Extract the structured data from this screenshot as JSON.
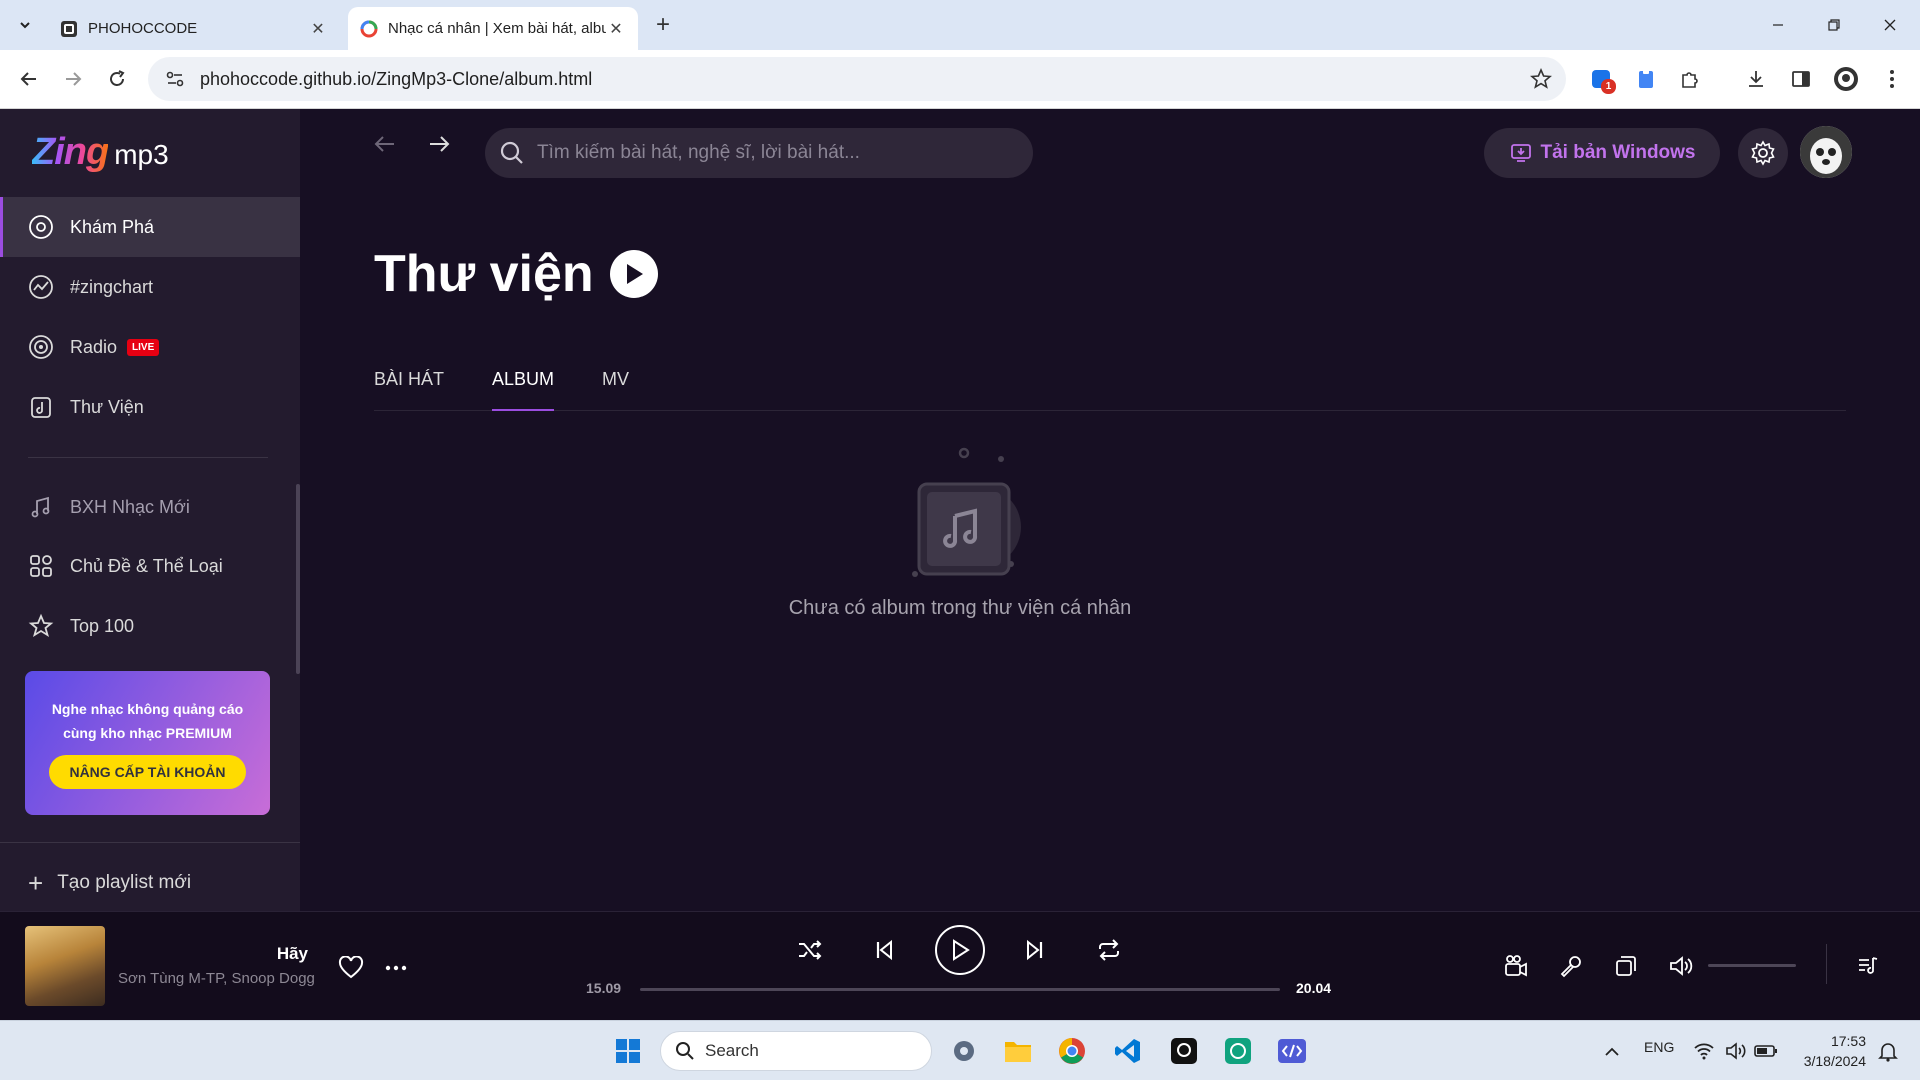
{
  "browser": {
    "tabs": [
      {
        "title": "PHOHOCCODE"
      },
      {
        "title": "Nhạc cá nhân | Xem bài hát, album"
      }
    ],
    "url": "phohoccode.github.io/ZingMp3-Clone/album.html",
    "extension_badge": "1"
  },
  "app": {
    "logo": {
      "brand": "Zing",
      "suffix": "mp3"
    },
    "sidebar": {
      "items": [
        {
          "label": "Khám Phá",
          "icon": "disc-icon"
        },
        {
          "label": "#zingchart",
          "icon": "chart-icon"
        },
        {
          "label": "Radio",
          "icon": "radio-icon",
          "badge": "LIVE"
        },
        {
          "label": "Thư Viện",
          "icon": "library-icon"
        }
      ],
      "secondary": [
        {
          "label": "BXH Nhạc Mới",
          "icon": "music-note-icon"
        },
        {
          "label": "Chủ Đề & Thể Loại",
          "icon": "category-icon"
        },
        {
          "label": "Top 100",
          "icon": "star-icon"
        }
      ],
      "promo": {
        "text": "Nghe nhạc không quảng cáo cùng kho nhạc PREMIUM",
        "button": "NÂNG CẤP TÀI KHOẢN"
      },
      "new_playlist": "Tạo playlist mới"
    },
    "header": {
      "search_placeholder": "Tìm kiếm bài hát, nghệ sĩ, lời bài hát...",
      "download_label": "Tải bản Windows"
    },
    "page": {
      "title": "Thư viện",
      "tabs": [
        "BÀI HÁT",
        "ALBUM",
        "MV"
      ],
      "selected_tab": "ALBUM",
      "empty_message": "Chưa có album trong thư viện cá nhân"
    },
    "player": {
      "song": "Hãy",
      "artist": "Sơn Tùng M-TP, Snoop Dogg",
      "current_time": "15.09",
      "duration": "20.04",
      "progress": 0.0
    }
  },
  "taskbar": {
    "search_label": "Search",
    "language": "ENG",
    "time": "17:53",
    "date": "3/18/2024"
  },
  "colors": {
    "accent": "#9b4de0",
    "download_text": "#c273ed",
    "premium_button": "#ffdb00",
    "live_badge": "#e60012"
  }
}
